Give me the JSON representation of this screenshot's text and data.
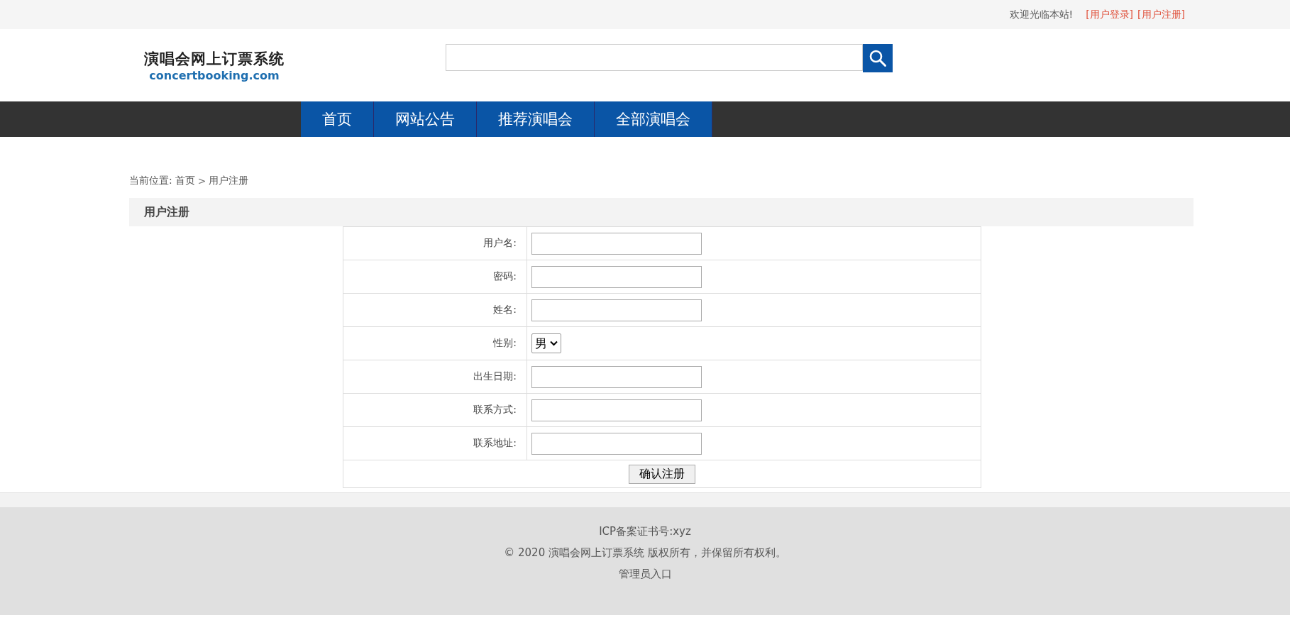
{
  "top_bar": {
    "welcome": "欢迎光临本站!",
    "links": [
      "[用户登录]",
      "[用户注册]"
    ]
  },
  "logo": {
    "title": "演唱会网上订票系统",
    "domain": "concertbooking.com"
  },
  "nav": [
    "首页",
    "网站公告",
    "推荐演唱会",
    "全部演唱会"
  ],
  "breadcrumb": {
    "prefix": "当前位置:",
    "home": "首页",
    "separator": ">",
    "current": "用户注册"
  },
  "panel_title": "用户注册",
  "form": [
    {
      "label": "用户名:",
      "kind": "input"
    },
    {
      "label": "密码:",
      "kind": "input"
    },
    {
      "label": "姓名:",
      "kind": "input"
    },
    {
      "label": "性别:",
      "kind": "select",
      "value": "男"
    },
    {
      "label": "出生日期:",
      "kind": "input"
    },
    {
      "label": "联系方式:",
      "kind": "input"
    },
    {
      "label": "联系地址:",
      "kind": "input"
    }
  ],
  "submit": "确认注册",
  "footer": [
    "ICP备案证书号:xyz",
    "© 2020 演唱会网上订票系统 版权所有，并保留所有权利。",
    "管理员入口"
  ]
}
